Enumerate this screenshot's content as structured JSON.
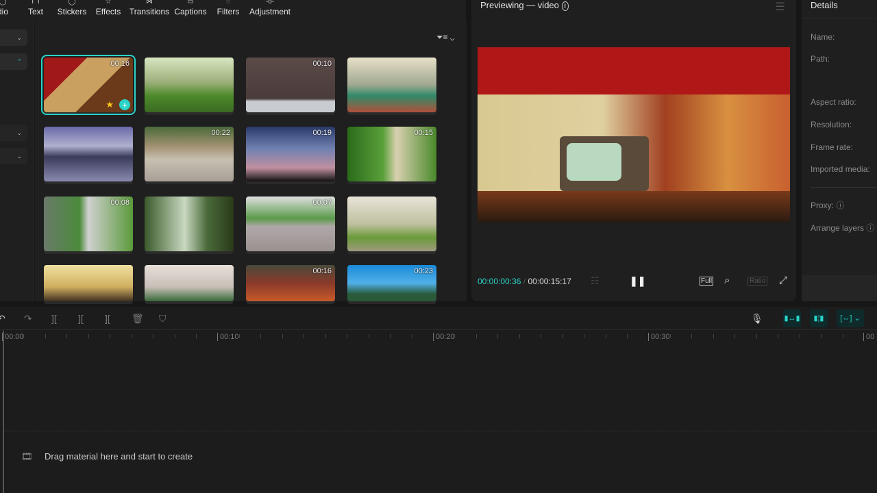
{
  "toolbar": {
    "items": [
      "dio",
      "Text",
      "Stickers",
      "Effects",
      "Transitions",
      "Captions",
      "Filters",
      "Adjustment"
    ]
  },
  "media": {
    "clips": [
      {
        "duration": "00:16",
        "selected": true,
        "bg": "linear-gradient(135deg,#a01818 0 30%,#c9a060 30% 60%,#6b3a1a 60%)"
      },
      {
        "duration": "",
        "bg": "linear-gradient(180deg,#d8e6c0 0,#9cb07a 45%,#4d8a2a 70%,#3a6a22)"
      },
      {
        "duration": "00:10",
        "bg": "linear-gradient(180deg,#5a4a48 0,#4a3c3a 75%,#c8ccd0 80%)"
      },
      {
        "duration": "",
        "bg": "linear-gradient(180deg,#e8e0c8 0,#a0a890 50%,#2f8a6a 70%,#b0503a)"
      },
      {
        "duration": "",
        "bg": "linear-gradient(180deg,#6a6aa8 0,#b0b0d0 35%,#3a3a5a 55%,#8a8ab0)"
      },
      {
        "duration": "00:22",
        "bg": "linear-gradient(180deg,#4a6a3a 0,#a09070 35%,#c8c0b0 60%,#a8a098)"
      },
      {
        "duration": "00:19",
        "bg": "linear-gradient(180deg,#2a3a6a 0,#7080b0 40%,#c090a0 75%,#111)"
      },
      {
        "duration": "00:15",
        "bg": "linear-gradient(90deg,#2a6a1a,#5aa03a 40%,#d8d0b0 55%,#4a8a2a)"
      },
      {
        "duration": "00:08",
        "bg": "linear-gradient(90deg,#6a7a6a,#4a8a3a 40%,#d0d0d0 50%,#5a9a3a)"
      },
      {
        "duration": "",
        "bg": "linear-gradient(90deg,#3a5a2a,#c8d8c0 45%,#4a6a3a 70%,#2a3a1a)"
      },
      {
        "duration": "00:07",
        "bg": "linear-gradient(180deg,#e0e0e0 0,#5a9a4a 40%,#b0a8a8 55%,#9a9090)"
      },
      {
        "duration": "",
        "bg": "linear-gradient(180deg,#e8e4d8 0,#c0c0a0 50%,#6a9a3a 75%,#a09a80)"
      },
      {
        "duration": "",
        "bg": "linear-gradient(180deg,#f0e0a0 0,#d0b060 60%,#403020)"
      },
      {
        "duration": "",
        "bg": "linear-gradient(180deg,#e8e0d8 0,#c8c0b8 60%,#3a6a3a)"
      },
      {
        "duration": "00:16",
        "bg": "linear-gradient(180deg,#4a4a3a 0,#8a3a2a 50%,#c85a2a)"
      },
      {
        "duration": "00:23",
        "bg": "linear-gradient(180deg,#1a8ad8 0,#50b0e8 50%,#2a5a3a 80%)"
      }
    ]
  },
  "preview": {
    "title": "Previewing — video",
    "current_time": "00:00:00:36",
    "separator": "/",
    "total_time": "00:00:15:17",
    "full_label": "Full",
    "ratio_label": "Ratio"
  },
  "details": {
    "title": "Details",
    "fields": [
      "Name:",
      "Path:",
      "Aspect ratio:",
      "Resolution:",
      "Frame rate:",
      "Imported media:"
    ],
    "proxy": "Proxy:",
    "arrange": "Arrange layers"
  },
  "timeline": {
    "ruler": [
      "00:00",
      "00:10",
      "00:20",
      "00:30",
      "00"
    ],
    "empty_hint": "Drag material here and start to create"
  },
  "colors": {
    "accent": "#2ad4c8"
  }
}
